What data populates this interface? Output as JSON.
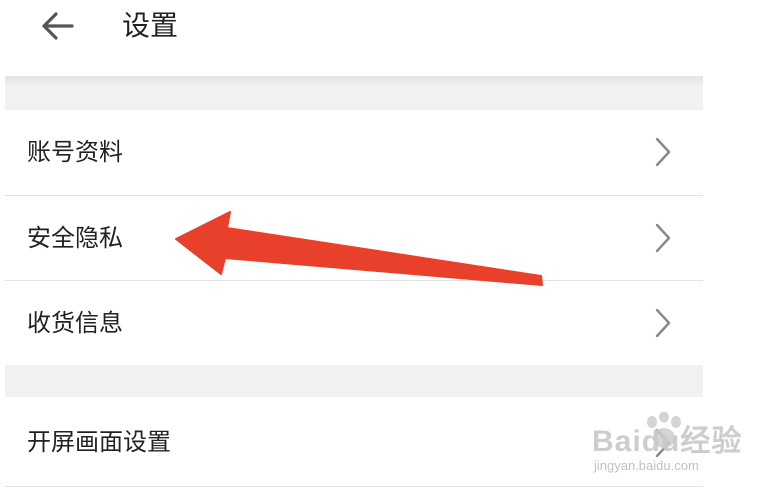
{
  "header": {
    "title": "设置"
  },
  "settings": {
    "items": [
      {
        "label": "账号资料"
      },
      {
        "label": "安全隐私"
      },
      {
        "label": "收货信息"
      },
      {
        "label": "开屏画面设置"
      }
    ]
  },
  "watermark": {
    "brand": "Baidu经验",
    "url": "jingyan.baidu.com"
  },
  "colors": {
    "annotation_arrow": "#e8402a",
    "separator": "#f1f1f1",
    "chevron": "#888888"
  }
}
